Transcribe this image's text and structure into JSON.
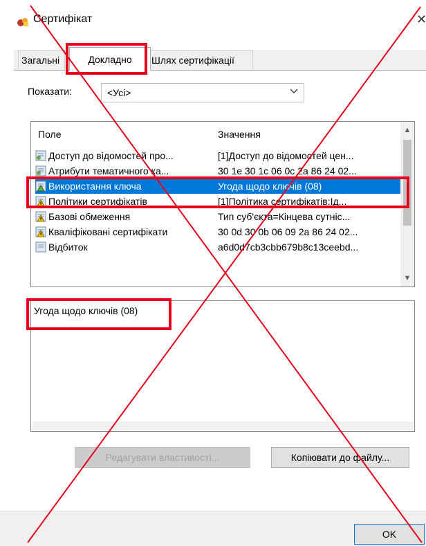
{
  "window": {
    "title": "Сертифікат"
  },
  "tabs": [
    {
      "label": "Загальні"
    },
    {
      "label": "Докладно"
    },
    {
      "label": "Шлях сертифікації"
    }
  ],
  "show": {
    "label": "Показати:",
    "value": "<Усі>"
  },
  "list": {
    "columns": [
      "Поле",
      "Значення"
    ],
    "rows": [
      {
        "field": "Доступ до відомостей про...",
        "value": "[1]Доступ до відомостей цен...",
        "icon": "cert-field-icon"
      },
      {
        "field": "Атрибути тематичного ка...",
        "value": "30 1e 30 1c 06 0c 2a 86 24 02...",
        "icon": "cert-field-icon"
      },
      {
        "field": "Використання ключа",
        "value": "Угода щодо ключів (08)",
        "icon": "cert-extension-icon",
        "selected": true
      },
      {
        "field": "Політики сертифікатів",
        "value": "[1]Політика сертифікатів:Ід...",
        "icon": "warning-extension-icon"
      },
      {
        "field": "Базові обмеження",
        "value": "Тип суб'єкта=Кінцева сутніс...",
        "icon": "warning-extension-icon"
      },
      {
        "field": "Кваліфіковані сертифікати",
        "value": "30 0d 30 0b 06 09 2a 86 24 02...",
        "icon": "warning-extension-icon"
      },
      {
        "field": "Відбиток",
        "value": "a6d0d7cb3cbb679b8c13ceebd...",
        "icon": "document-icon"
      }
    ]
  },
  "detail": {
    "text": "Угода щодо ключів (08)"
  },
  "buttons": {
    "edit": "Редагувати властивості...",
    "copy": "Копіювати до файлу...",
    "ok": "OK"
  },
  "colors": {
    "selection": "#0078d7",
    "highlight": "#e8001c"
  }
}
